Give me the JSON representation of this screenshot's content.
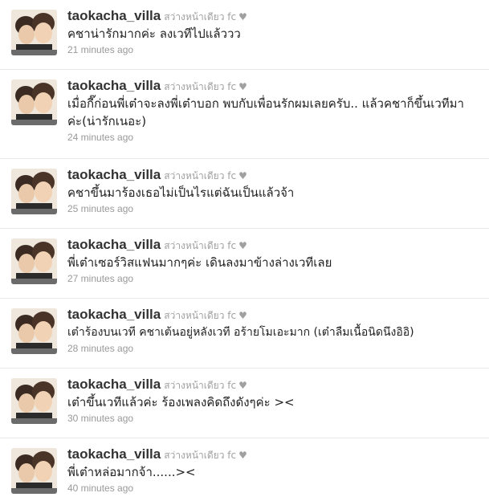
{
  "tweets": [
    {
      "username": "taokacha_villa",
      "display_name": "สว่างหน้าเดียว fc",
      "heart": "♥",
      "text": "คชาน่ารักมากค่ะ ลงเวทีไปแล้ววว",
      "time": "21 minutes ago"
    },
    {
      "username": "taokacha_villa",
      "display_name": "สว่างหน้าเดียว fc",
      "heart": "♥",
      "text": "เมื่อกี๊ก่อนพี่เต๋าจะลงพี่เต๋าบอก พบกับเพื่อนรักผมเลยครับ.. แล้วคชาก็ขึ้นเวทีมาค่ะ(น่ารักเนอะ)",
      "time": "24 minutes ago"
    },
    {
      "username": "taokacha_villa",
      "display_name": "สว่างหน้าเดียว fc",
      "heart": "♥",
      "text": "คชาขึ้นมาร้องเธอไม่เป็นไรแต่ฉันเป็นแล้วจ้า",
      "time": "25 minutes ago"
    },
    {
      "username": "taokacha_villa",
      "display_name": "สว่างหน้าเดียว fc",
      "heart": "♥",
      "text": "พี่เต๋าเซอร์วิสแฟนมากๆค่ะ เดินลงมาข้างล่างเวทีเลย",
      "time": "27 minutes ago"
    },
    {
      "username": "taokacha_villa",
      "display_name": "สว่างหน้าเดียว fc",
      "heart": "♥",
      "text": "เต๋าร้องบนเวที คชาเต้นอยู่หลังเวที อร้ายโมเอะมาก (เต๋าลืมเนื้อนิดนึงอิอิ)",
      "time": "28 minutes ago"
    },
    {
      "username": "taokacha_villa",
      "display_name": "สว่างหน้าเดียว fc",
      "heart": "♥",
      "text": "เต๋าขึ้นเวทีแล้วค่ะ ร้องเพลงคิดถึงดังๆค่ะ ><",
      "time": "30 minutes ago"
    },
    {
      "username": "taokacha_villa",
      "display_name": "สว่างหน้าเดียว fc",
      "heart": "♥",
      "text": "พี่เต๋าหล่อมากจ้า......><",
      "time": "40 minutes ago"
    }
  ]
}
